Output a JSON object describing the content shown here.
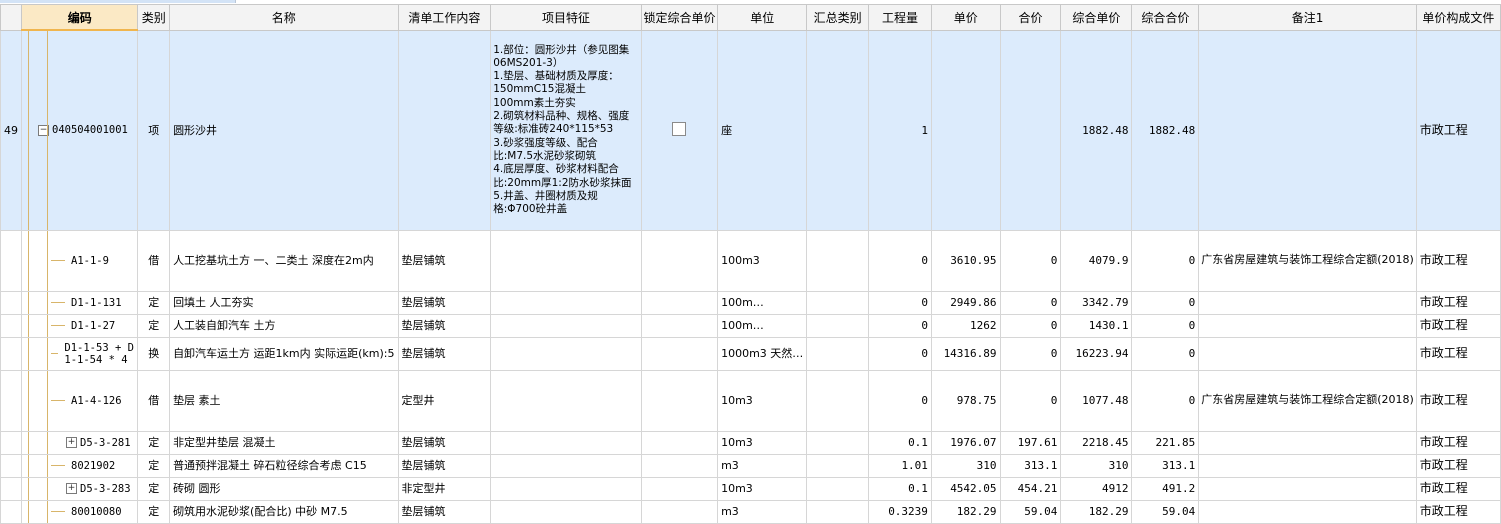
{
  "headers": [
    "",
    "编码",
    "类别",
    "名称",
    "清单工作内容",
    "项目特征",
    "锁定综合单价",
    "单位",
    "汇总类别",
    "工程量",
    "单价",
    "合价",
    "综合单价",
    "综合合价",
    "备注1",
    "单价构成文件"
  ],
  "main_row": {
    "row_no": "49",
    "toggle": "−",
    "code": "040504001001",
    "type": "项",
    "name": "圆形沙井",
    "work": "",
    "feature_lines": [
      "1.部位：圆形沙井（参见图集",
      "06MS201-3）",
      "1.垫层、基础材质及厚度：",
      "150mmC15混凝土",
      "100mm素土夯实",
      "2.砌筑材料品种、规格、强度",
      "等级:标准砖240*115*53",
      "3.砂浆强度等级、配合",
      "比:M7.5水泥砂浆砌筑",
      "4.底层厚度、砂浆材料配合",
      "比:20mm厚1:2防水砂浆抹面",
      "5.井盖、井圈材质及规",
      "格:Φ700砼井盖"
    ],
    "unit": "座",
    "summary_type": "",
    "qty": "1",
    "price": "",
    "amount": "",
    "comp_price": "1882.48",
    "comp_amount": "1882.48",
    "note": "",
    "file": "市政工程"
  },
  "sub_rows": [
    {
      "toggle": "",
      "code": "A1-1-9",
      "type": "借",
      "name": "人工挖基坑土方 一、二类土 深度在2m内",
      "work": "垫层铺筑",
      "unit": "100m3",
      "qty": "0",
      "price": "3610.95",
      "amount": "0",
      "comp_price": "4079.9",
      "comp_amount": "0",
      "note": "广东省房屋建筑与装饰工程综合定额(2018)",
      "file": "市政工程",
      "h": 61
    },
    {
      "toggle": "",
      "code": "D1-1-131",
      "type": "定",
      "name": "回填土 人工夯实",
      "work": "垫层铺筑",
      "unit": "100m…",
      "qty": "0",
      "price": "2949.86",
      "amount": "0",
      "comp_price": "3342.79",
      "comp_amount": "0",
      "note": "",
      "file": "市政工程",
      "h": 23
    },
    {
      "toggle": "",
      "code": "D1-1-27",
      "type": "定",
      "name": "人工装自卸汽车 土方",
      "work": "垫层铺筑",
      "unit": "100m…",
      "qty": "0",
      "price": "1262",
      "amount": "0",
      "comp_price": "1430.1",
      "comp_amount": "0",
      "note": "",
      "file": "市政工程",
      "h": 23
    },
    {
      "toggle": "",
      "code": "D1-1-53 + D1-1-54 * 4",
      "type": "换",
      "name": "自卸汽车运土方 运距1km内  实际运距(km):5",
      "work": "垫层铺筑",
      "unit": "1000m3 天然…",
      "qty": "0",
      "price": "14316.89",
      "amount": "0",
      "comp_price": "16223.94",
      "comp_amount": "0",
      "note": "",
      "file": "市政工程",
      "h": 33
    },
    {
      "toggle": "",
      "code": "A1-4-126",
      "type": "借",
      "name": "垫层 素土",
      "work": "定型井",
      "unit": "10m3",
      "qty": "0",
      "price": "978.75",
      "amount": "0",
      "comp_price": "1077.48",
      "comp_amount": "0",
      "note": "广东省房屋建筑与装饰工程综合定额(2018)",
      "file": "市政工程",
      "h": 61
    },
    {
      "toggle": "+",
      "code": "D5-3-281",
      "type": "定",
      "name": "非定型井垫层 混凝土",
      "work": "垫层铺筑",
      "unit": "10m3",
      "qty": "0.1",
      "price": "1976.07",
      "amount": "197.61",
      "comp_price": "2218.45",
      "comp_amount": "221.85",
      "note": "",
      "file": "市政工程",
      "h": 23
    },
    {
      "toggle": "",
      "code": "8021902",
      "type": "定",
      "name": "普通预拌混凝土 碎石粒径综合考虑 C15",
      "work": "垫层铺筑",
      "unit": "m3",
      "qty": "1.01",
      "price": "310",
      "amount": "313.1",
      "comp_price": "310",
      "comp_amount": "313.1",
      "note": "",
      "file": "市政工程",
      "h": 23
    },
    {
      "toggle": "+",
      "code": "D5-3-283",
      "type": "定",
      "name": "砖砌 圆形",
      "work": "非定型井",
      "unit": "10m3",
      "qty": "0.1",
      "price": "4542.05",
      "amount": "454.21",
      "comp_price": "4912",
      "comp_amount": "491.2",
      "note": "",
      "file": "市政工程",
      "h": 23
    },
    {
      "toggle": "",
      "code": "80010080",
      "type": "定",
      "name": "砌筑用水泥砂浆(配合比) 中砂 M7.5",
      "work": "垫层铺筑",
      "unit": "m3",
      "qty": "0.3239",
      "price": "182.29",
      "amount": "59.04",
      "comp_price": "182.29",
      "comp_amount": "59.04",
      "note": "",
      "file": "市政工程",
      "h": 23
    }
  ]
}
